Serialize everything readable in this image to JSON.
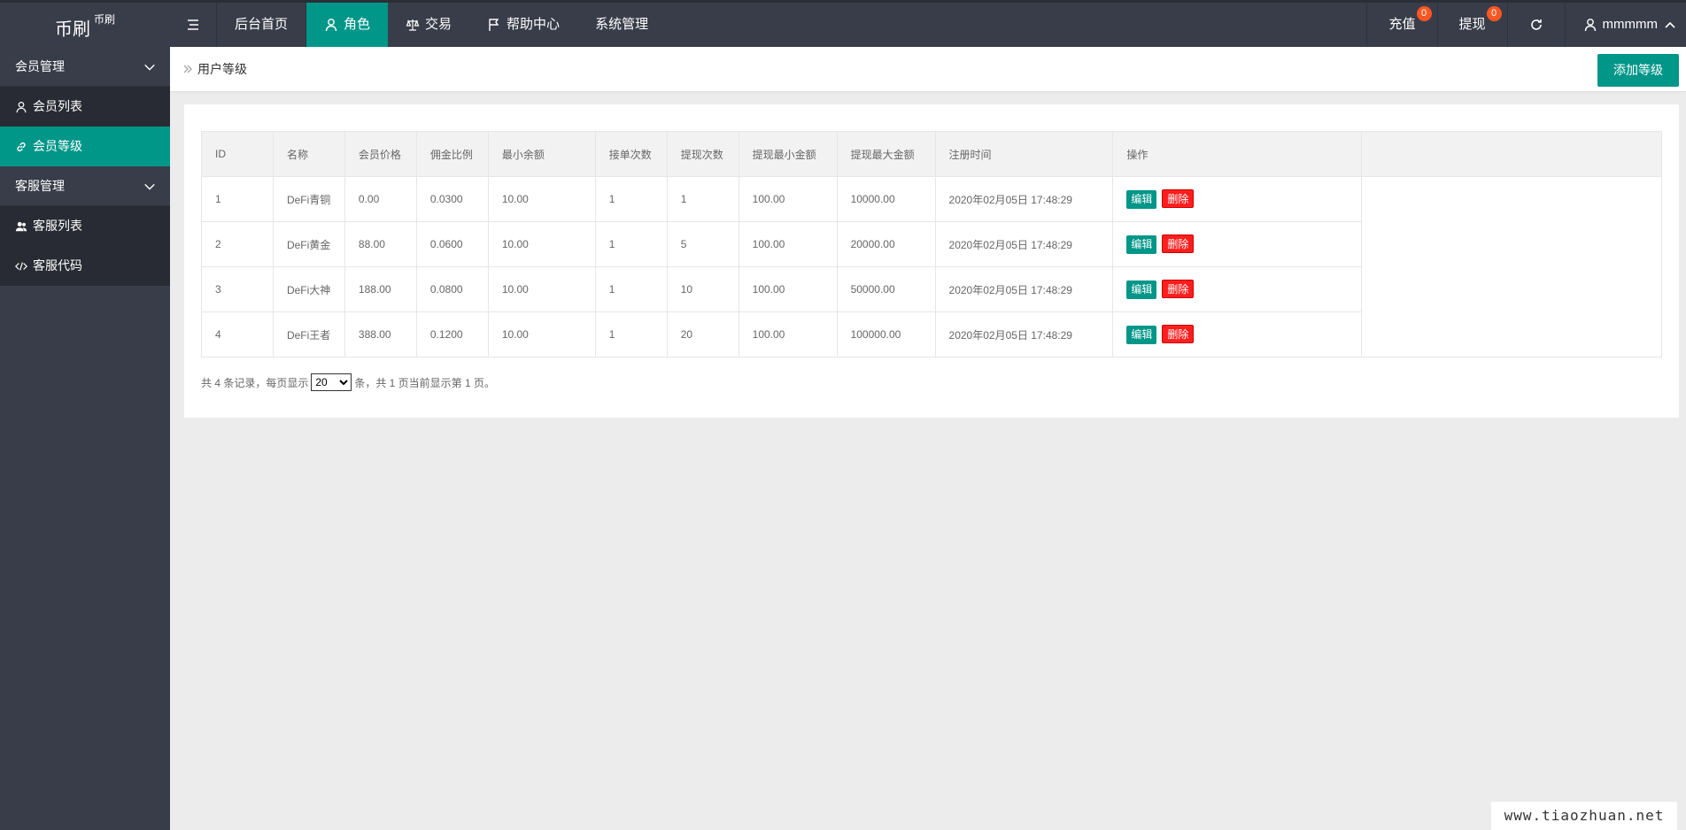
{
  "header": {
    "logo_text": "币刷",
    "logo_sup": "币刷",
    "menu_icon": "menu-icon",
    "nav": [
      {
        "label": "后台首页",
        "icon": ""
      },
      {
        "label": "角色",
        "icon": "user-icon",
        "active": true
      },
      {
        "label": "交易",
        "icon": "balance-icon"
      },
      {
        "label": "帮助中心",
        "icon": "flag-icon"
      },
      {
        "label": "系统管理",
        "icon": ""
      }
    ],
    "right": {
      "recharge_label": "充值",
      "recharge_badge": "0",
      "withdraw_label": "提现",
      "withdraw_badge": "0",
      "refresh_icon": "refresh-icon",
      "username": "mmmmm"
    }
  },
  "sidebar": {
    "groups": [
      {
        "label": "会员管理",
        "items": [
          {
            "label": "会员列表",
            "icon": "user-icon"
          },
          {
            "label": "会员等级",
            "icon": "link-icon",
            "active": true
          }
        ]
      },
      {
        "label": "客服管理",
        "items": [
          {
            "label": "客服列表",
            "icon": "users-icon"
          },
          {
            "label": "客服代码",
            "icon": "code-icon"
          }
        ]
      }
    ]
  },
  "breadcrumb": {
    "label": "用户等级"
  },
  "toolbar": {
    "add_label": "添加等级"
  },
  "colors": {
    "accent": "#009688",
    "danger": "#ff1e1e",
    "topbar": "#393d49",
    "sidebar": "#393d49",
    "sub": "#282b33",
    "badge": "#ff5722"
  },
  "table": {
    "columns": [
      "ID",
      "名称",
      "会员价格",
      "佣金比例",
      "最小余额",
      "接单次数",
      "提现次数",
      "提现最小金额",
      "提现最大金额",
      "注册时间",
      "操作"
    ],
    "rows": [
      [
        "1",
        "DeFi青铜",
        "0.00",
        "0.0300",
        "10.00",
        "1",
        "1",
        "100.00",
        "10000.00",
        "2020年02月05日 17:48:29"
      ],
      [
        "2",
        "DeFi黄金",
        "88.00",
        "0.0600",
        "10.00",
        "1",
        "5",
        "100.00",
        "20000.00",
        "2020年02月05日 17:48:29"
      ],
      [
        "3",
        "DeFi大神",
        "188.00",
        "0.0800",
        "10.00",
        "1",
        "10",
        "100.00",
        "50000.00",
        "2020年02月05日 17:48:29"
      ],
      [
        "4",
        "DeFi王者",
        "388.00",
        "0.1200",
        "10.00",
        "1",
        "20",
        "100.00",
        "100000.00",
        "2020年02月05日 17:48:29"
      ]
    ],
    "edit_label": "编辑",
    "delete_label": "删除"
  },
  "pager": {
    "prefix": "共 4 条记录，每页显示",
    "page_size": "20",
    "suffix": "条，共 1 页当前显示第 1 页。"
  },
  "watermark": "www.tiaozhuan.net"
}
